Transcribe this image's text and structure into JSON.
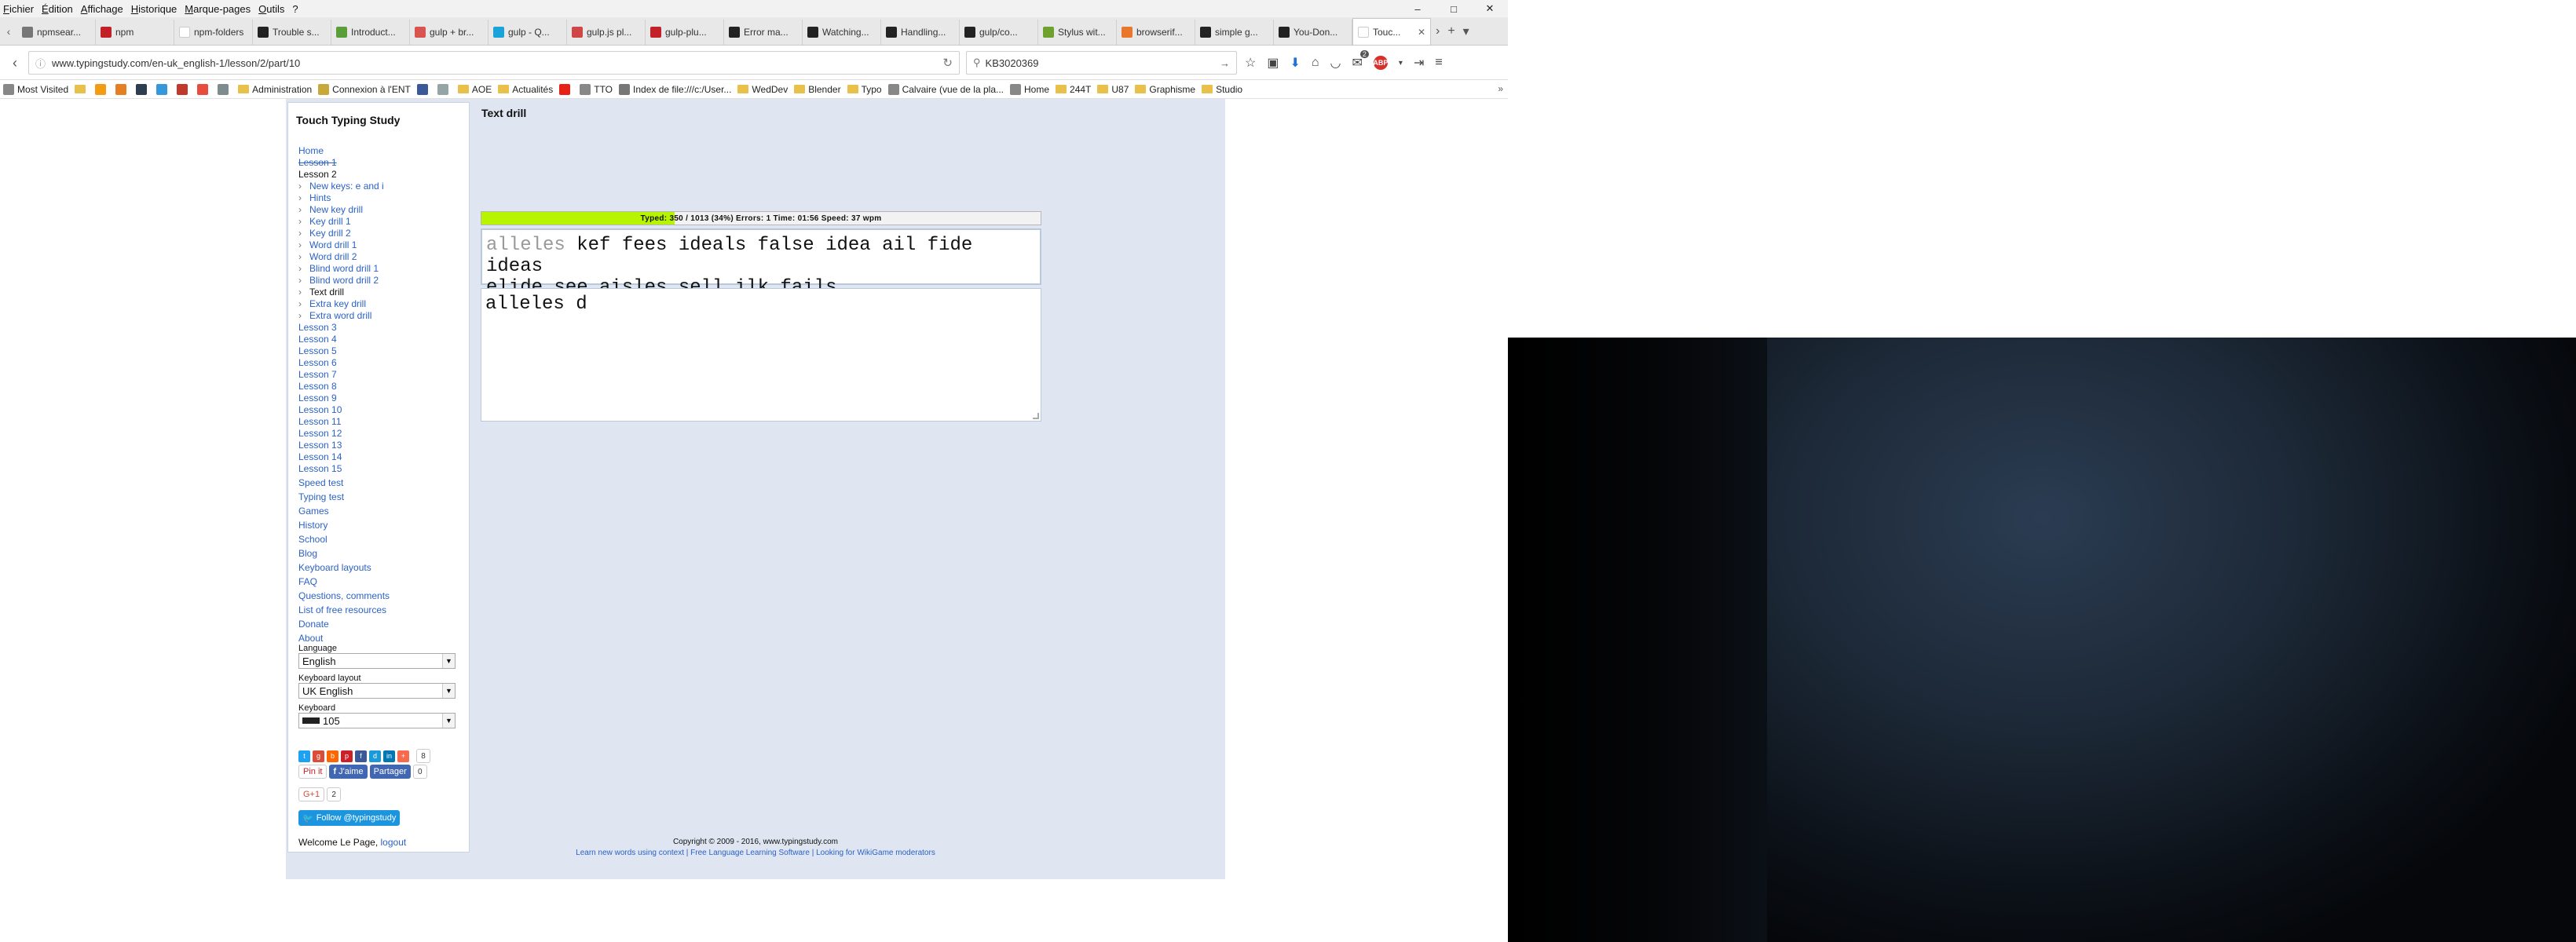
{
  "menubar": [
    "Fichier",
    "Édition",
    "Affichage",
    "Historique",
    "Marque-pages",
    "Outils",
    "?"
  ],
  "window_controls": [
    "–",
    "□",
    "✕"
  ],
  "tabs": [
    {
      "label": "npmsear...",
      "color": "#777777"
    },
    {
      "label": "npm",
      "color": "#c12127"
    },
    {
      "label": "npm-folders",
      "color": "#ffffff"
    },
    {
      "label": "Trouble s...",
      "color": "#222222"
    },
    {
      "label": "Introduct...",
      "color": "#5a9e3a"
    },
    {
      "label": "gulp + br...",
      "color": "#d9534f"
    },
    {
      "label": "gulp - Q...",
      "color": "#1aa3d9"
    },
    {
      "label": "gulp.js pl...",
      "color": "#cf4647"
    },
    {
      "label": "gulp-plu...",
      "color": "#c12127"
    },
    {
      "label": "Error ma...",
      "color": "#222222"
    },
    {
      "label": "Watching...",
      "color": "#222222"
    },
    {
      "label": "Handling...",
      "color": "#222222"
    },
    {
      "label": "gulp/co...",
      "color": "#222222"
    },
    {
      "label": "Stylus wit...",
      "color": "#6ea22f"
    },
    {
      "label": "browserif...",
      "color": "#e8762b"
    },
    {
      "label": "simple g...",
      "color": "#222222"
    },
    {
      "label": "You-Don...",
      "color": "#222222"
    },
    {
      "label": "Touc...",
      "color": "#ffffff",
      "active": true
    }
  ],
  "tab_actions": [
    "›",
    "+",
    "▾"
  ],
  "nav": {
    "back": "‹",
    "info": "ⓘ",
    "url": "www.typingstudy.com/en-uk_english-1/lesson/2/part/10",
    "reload": "↻",
    "search_value": "KB3020369",
    "search_go": "→",
    "toolbar_icons": [
      "☆",
      "▣",
      "⬇",
      "⌂",
      "◡",
      "✉",
      "ABP",
      "▾",
      "⇥",
      "≡"
    ],
    "mail_count": "2"
  },
  "bookmarks": [
    {
      "label": "Most Visited",
      "type": "site",
      "color": "#888888"
    },
    {
      "label": "",
      "type": "folder"
    },
    {
      "label": "",
      "type": "site",
      "color": "#f39c12"
    },
    {
      "label": "",
      "type": "site",
      "color": "#e67e22"
    },
    {
      "label": "",
      "type": "site",
      "color": "#2c3e50"
    },
    {
      "label": "",
      "type": "site",
      "color": "#3498db"
    },
    {
      "label": "",
      "type": "site",
      "color": "#c0392b"
    },
    {
      "label": "",
      "type": "site",
      "color": "#e74c3c"
    },
    {
      "label": "",
      "type": "site",
      "color": "#7f8c8d"
    },
    {
      "label": "Administration",
      "type": "folder"
    },
    {
      "label": "Connexion à l'ENT",
      "type": "site",
      "color": "#c8a83b"
    },
    {
      "label": "",
      "type": "site",
      "color": "#3b5998"
    },
    {
      "label": "",
      "type": "site",
      "color": "#95a5a6"
    },
    {
      "label": "AOE",
      "type": "folder"
    },
    {
      "label": "Actualités",
      "type": "folder"
    },
    {
      "label": "",
      "type": "site",
      "color": "#e62117"
    },
    {
      "label": "TTO",
      "type": "site",
      "color": "#888888"
    },
    {
      "label": "Index de file:///c:/User...",
      "type": "site",
      "color": "#777777"
    },
    {
      "label": "WedDev",
      "type": "folder"
    },
    {
      "label": "Blender",
      "type": "folder"
    },
    {
      "label": "Typo",
      "type": "folder"
    },
    {
      "label": "Calvaire (vue de la pla...",
      "type": "site",
      "color": "#888888"
    },
    {
      "label": "Home",
      "type": "site",
      "color": "#888888"
    },
    {
      "label": "244T",
      "type": "folder"
    },
    {
      "label": "U87",
      "type": "folder"
    },
    {
      "label": "Graphisme",
      "type": "folder"
    },
    {
      "label": "Studio",
      "type": "folder"
    }
  ],
  "bookmarks_overflow": "»",
  "sidebar": {
    "title": "Touch Typing Study",
    "home": "Home",
    "lesson1": "Lesson 1",
    "lesson2": "Lesson 2",
    "lesson2_parts": [
      "New keys: e and i",
      "Hints",
      "New key drill",
      "Key drill 1",
      "Key drill 2",
      "Word drill 1",
      "Word drill 2",
      "Blind word drill 1",
      "Blind word drill 2",
      "Text drill",
      "Extra key drill",
      "Extra word drill"
    ],
    "current_part_index": 9,
    "lessons": [
      "Lesson 3",
      "Lesson 4",
      "Lesson 5",
      "Lesson 6",
      "Lesson 7",
      "Lesson 8",
      "Lesson 9",
      "Lesson 10",
      "Lesson 11",
      "Lesson 12",
      "Lesson 13",
      "Lesson 14",
      "Lesson 15"
    ],
    "extras": [
      "Speed test",
      "Typing test",
      "Games",
      "History",
      "School",
      "Blog",
      "Keyboard layouts",
      "FAQ",
      "Questions, comments",
      "List of free resources",
      "Donate",
      "About"
    ],
    "language_label": "Language",
    "language_value": "English",
    "keyboard_layout_label": "Keyboard layout",
    "keyboard_layout_value": "UK English",
    "keyboard_label": "Keyboard",
    "keyboard_value": "105",
    "share_count": "8",
    "pinit": "Pin it",
    "like": "J'aime",
    "partager": "Partager",
    "partager_count": "0",
    "gplus": "G+1",
    "gplus_count": "2",
    "twitter_follow": "Follow @typingstudy",
    "welcome": "Welcome Le Page,",
    "logout": "logout"
  },
  "main": {
    "title": "Text drill",
    "progress_fraction": 0.345,
    "stats": "Typed: 350 / 1013 (34%) Errors: 1 Time: 01:56 Speed: 37 wpm",
    "typed_text": "alleles",
    "remaining_line1": " kef fees ideals false idea ail fide ideas",
    "remaining_line2": "elide see aisles sell ilk fails",
    "input_value": "alleles d"
  },
  "footer": {
    "copyright": "Copyright © 2009 - 2016, www.typingstudy.com",
    "links": "Learn new words using context | Free Language Learning Software | Looking for WikiGame moderators"
  }
}
